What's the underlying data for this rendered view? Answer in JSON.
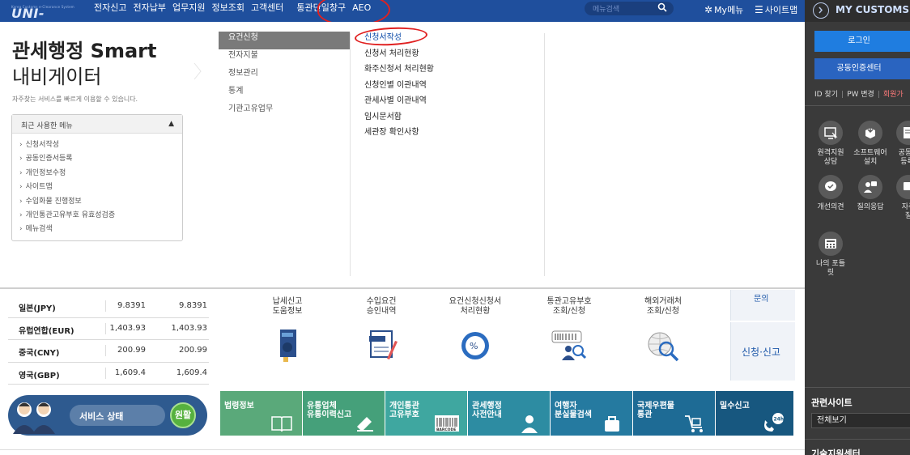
{
  "topnav": {
    "logo_sub": "Korea Customs e-Clearance System",
    "logo_main": "UNI-PASS",
    "items": [
      "전자신고",
      "전자납부",
      "업무지원",
      "정보조회",
      "고객센터",
      "통관단일창구",
      "AEO"
    ],
    "search_placeholder": "메뉴검색",
    "mymenu": "My메뉴",
    "sitemap": "사이트맵"
  },
  "right_panel": {
    "title": "MY CUSTOMS",
    "login": "로그인",
    "cert_center": "공동인증센터",
    "id_find": "ID 찾기",
    "pw_change": "PW 변경",
    "register": "회원가",
    "icons": [
      {
        "label": "원격지원\n상담",
        "icon": "monitor-icon"
      },
      {
        "label": "소프트웨어\n설치",
        "icon": "download-box-icon"
      },
      {
        "label": "공동인\n등록/",
        "icon": "document-icon"
      },
      {
        "label": "개선의견",
        "icon": "chat-check-icon"
      },
      {
        "label": "질의응답",
        "icon": "qa-icon"
      },
      {
        "label": "자주\n질",
        "icon": "faq-icon"
      },
      {
        "label": "나의 포틀\n릿",
        "icon": "calculator-icon"
      }
    ],
    "related_sites": "관련사이트",
    "related_select": "전체보기",
    "tech_center": "기술지원센터"
  },
  "navigator": {
    "title_line1": "관세행정 Smart",
    "title_line2": "내비게이터",
    "description": "자주찾는 서비스를 빠르게 이용할 수 있습니다.",
    "recent_header": "최근 사용한 메뉴",
    "recent_items": [
      "신청서작성",
      "공동인증서등록",
      "개인정보수정",
      "사이트맵",
      "수입화물 진행정보",
      "개인통관고유부호 유효성검증",
      "메뉴검색"
    ]
  },
  "dropdown": {
    "categories": [
      "요건신청",
      "전자지불",
      "정보관리",
      "통계",
      "기관고유업무"
    ],
    "selected_category": "요건신청",
    "subitems": [
      "신청서작성",
      "신청서 처리현황",
      "화주신청서 처리현황",
      "신청인별 이관내역",
      "관세사별 이관내역",
      "임시문서함",
      "세관장 확인사항"
    ]
  },
  "exchange": [
    {
      "currency": "일본(JPY)",
      "v1": "9.8391",
      "v2": "9.8391"
    },
    {
      "currency": "유럽연합(EUR)",
      "v1": "1,403.93",
      "v2": "1,403.93"
    },
    {
      "currency": "중국(CNY)",
      "v1": "200.99",
      "v2": "200.99"
    },
    {
      "currency": "영국(GBP)",
      "v1": "1,609.4",
      "v2": "1,609.4"
    }
  ],
  "service_status": {
    "label": "서비스 상태",
    "status": "원활"
  },
  "quick_services": [
    {
      "title": "납세신고\n도움정보",
      "icon": "help-book-icon"
    },
    {
      "title": "수입요건\n승인내역",
      "icon": "import-doc-icon"
    },
    {
      "title": "요건신청신청서\n처리현황",
      "icon": "percent-globe-icon"
    },
    {
      "title": "통관고유부호\n조회/신청",
      "icon": "barcode-person-icon"
    },
    {
      "title": "해외거래처\n조회/신청",
      "icon": "globe-search-icon"
    }
  ],
  "side_cards": {
    "top": "문의",
    "sign": "신청·신고"
  },
  "tiles": [
    {
      "title": "법령정보",
      "color": "#5aa97a",
      "icon": "book-icon"
    },
    {
      "title": "유통업체\n유통이력신고",
      "color": "#45a07a",
      "icon": "eraser-icon"
    },
    {
      "title": "개인통관\n고유부호",
      "color": "#3fa7a0",
      "icon": "barcode-icon",
      "barcode_text": "BARCODE"
    },
    {
      "title": "관세행정\n사전안내",
      "color": "#2d8ca2",
      "icon": "person-icon"
    },
    {
      "title": "여행자\n분실물검색",
      "color": "#257aa0",
      "icon": "bag-icon"
    },
    {
      "title": "국제우편물\n통관",
      "color": "#1e6b95",
      "icon": "cart-icon"
    },
    {
      "title": "밀수신고",
      "color": "#17577f",
      "icon": "phone-24h-icon",
      "badge": "24h"
    }
  ]
}
